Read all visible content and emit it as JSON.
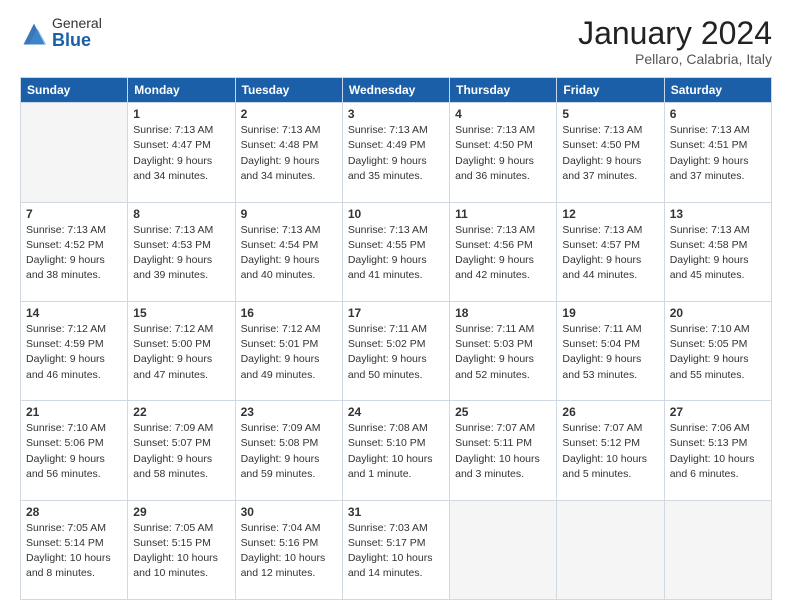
{
  "logo": {
    "general": "General",
    "blue": "Blue"
  },
  "title": "January 2024",
  "subtitle": "Pellaro, Calabria, Italy",
  "weekdays": [
    "Sunday",
    "Monday",
    "Tuesday",
    "Wednesday",
    "Thursday",
    "Friday",
    "Saturday"
  ],
  "weeks": [
    [
      {
        "day": "",
        "info": ""
      },
      {
        "day": "1",
        "info": "Sunrise: 7:13 AM\nSunset: 4:47 PM\nDaylight: 9 hours\nand 34 minutes."
      },
      {
        "day": "2",
        "info": "Sunrise: 7:13 AM\nSunset: 4:48 PM\nDaylight: 9 hours\nand 34 minutes."
      },
      {
        "day": "3",
        "info": "Sunrise: 7:13 AM\nSunset: 4:49 PM\nDaylight: 9 hours\nand 35 minutes."
      },
      {
        "day": "4",
        "info": "Sunrise: 7:13 AM\nSunset: 4:50 PM\nDaylight: 9 hours\nand 36 minutes."
      },
      {
        "day": "5",
        "info": "Sunrise: 7:13 AM\nSunset: 4:50 PM\nDaylight: 9 hours\nand 37 minutes."
      },
      {
        "day": "6",
        "info": "Sunrise: 7:13 AM\nSunset: 4:51 PM\nDaylight: 9 hours\nand 37 minutes."
      }
    ],
    [
      {
        "day": "7",
        "info": "Sunrise: 7:13 AM\nSunset: 4:52 PM\nDaylight: 9 hours\nand 38 minutes."
      },
      {
        "day": "8",
        "info": "Sunrise: 7:13 AM\nSunset: 4:53 PM\nDaylight: 9 hours\nand 39 minutes."
      },
      {
        "day": "9",
        "info": "Sunrise: 7:13 AM\nSunset: 4:54 PM\nDaylight: 9 hours\nand 40 minutes."
      },
      {
        "day": "10",
        "info": "Sunrise: 7:13 AM\nSunset: 4:55 PM\nDaylight: 9 hours\nand 41 minutes."
      },
      {
        "day": "11",
        "info": "Sunrise: 7:13 AM\nSunset: 4:56 PM\nDaylight: 9 hours\nand 42 minutes."
      },
      {
        "day": "12",
        "info": "Sunrise: 7:13 AM\nSunset: 4:57 PM\nDaylight: 9 hours\nand 44 minutes."
      },
      {
        "day": "13",
        "info": "Sunrise: 7:13 AM\nSunset: 4:58 PM\nDaylight: 9 hours\nand 45 minutes."
      }
    ],
    [
      {
        "day": "14",
        "info": "Sunrise: 7:12 AM\nSunset: 4:59 PM\nDaylight: 9 hours\nand 46 minutes."
      },
      {
        "day": "15",
        "info": "Sunrise: 7:12 AM\nSunset: 5:00 PM\nDaylight: 9 hours\nand 47 minutes."
      },
      {
        "day": "16",
        "info": "Sunrise: 7:12 AM\nSunset: 5:01 PM\nDaylight: 9 hours\nand 49 minutes."
      },
      {
        "day": "17",
        "info": "Sunrise: 7:11 AM\nSunset: 5:02 PM\nDaylight: 9 hours\nand 50 minutes."
      },
      {
        "day": "18",
        "info": "Sunrise: 7:11 AM\nSunset: 5:03 PM\nDaylight: 9 hours\nand 52 minutes."
      },
      {
        "day": "19",
        "info": "Sunrise: 7:11 AM\nSunset: 5:04 PM\nDaylight: 9 hours\nand 53 minutes."
      },
      {
        "day": "20",
        "info": "Sunrise: 7:10 AM\nSunset: 5:05 PM\nDaylight: 9 hours\nand 55 minutes."
      }
    ],
    [
      {
        "day": "21",
        "info": "Sunrise: 7:10 AM\nSunset: 5:06 PM\nDaylight: 9 hours\nand 56 minutes."
      },
      {
        "day": "22",
        "info": "Sunrise: 7:09 AM\nSunset: 5:07 PM\nDaylight: 9 hours\nand 58 minutes."
      },
      {
        "day": "23",
        "info": "Sunrise: 7:09 AM\nSunset: 5:08 PM\nDaylight: 9 hours\nand 59 minutes."
      },
      {
        "day": "24",
        "info": "Sunrise: 7:08 AM\nSunset: 5:10 PM\nDaylight: 10 hours\nand 1 minute."
      },
      {
        "day": "25",
        "info": "Sunrise: 7:07 AM\nSunset: 5:11 PM\nDaylight: 10 hours\nand 3 minutes."
      },
      {
        "day": "26",
        "info": "Sunrise: 7:07 AM\nSunset: 5:12 PM\nDaylight: 10 hours\nand 5 minutes."
      },
      {
        "day": "27",
        "info": "Sunrise: 7:06 AM\nSunset: 5:13 PM\nDaylight: 10 hours\nand 6 minutes."
      }
    ],
    [
      {
        "day": "28",
        "info": "Sunrise: 7:05 AM\nSunset: 5:14 PM\nDaylight: 10 hours\nand 8 minutes."
      },
      {
        "day": "29",
        "info": "Sunrise: 7:05 AM\nSunset: 5:15 PM\nDaylight: 10 hours\nand 10 minutes."
      },
      {
        "day": "30",
        "info": "Sunrise: 7:04 AM\nSunset: 5:16 PM\nDaylight: 10 hours\nand 12 minutes."
      },
      {
        "day": "31",
        "info": "Sunrise: 7:03 AM\nSunset: 5:17 PM\nDaylight: 10 hours\nand 14 minutes."
      },
      {
        "day": "",
        "info": ""
      },
      {
        "day": "",
        "info": ""
      },
      {
        "day": "",
        "info": ""
      }
    ]
  ]
}
